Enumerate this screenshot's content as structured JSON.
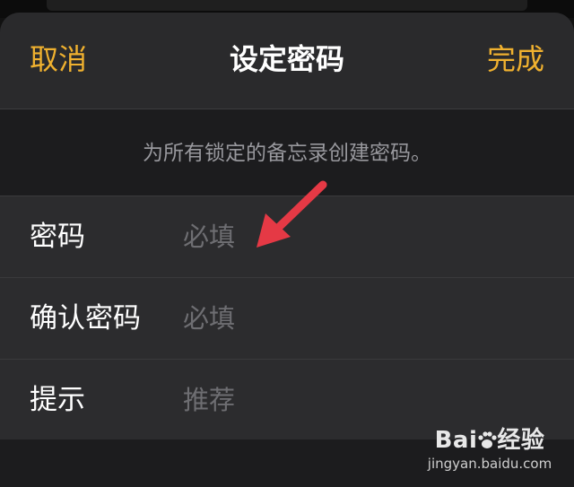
{
  "navbar": {
    "cancel_label": "取消",
    "title": "设定密码",
    "done_label": "完成"
  },
  "description": "为所有锁定的备忘录创建密码。",
  "form": {
    "rows": [
      {
        "label": "密码",
        "placeholder": "必填"
      },
      {
        "label": "确认密码",
        "placeholder": "必填"
      },
      {
        "label": "提示",
        "placeholder": "推荐"
      }
    ]
  },
  "colors": {
    "accent": "#f0b12f",
    "annotation_arrow": "#e53945",
    "background": "#1c1c1e"
  },
  "watermark": {
    "brand": "Bai",
    "brand_suffix": "经验",
    "url": "jingyan.baidu.com"
  }
}
